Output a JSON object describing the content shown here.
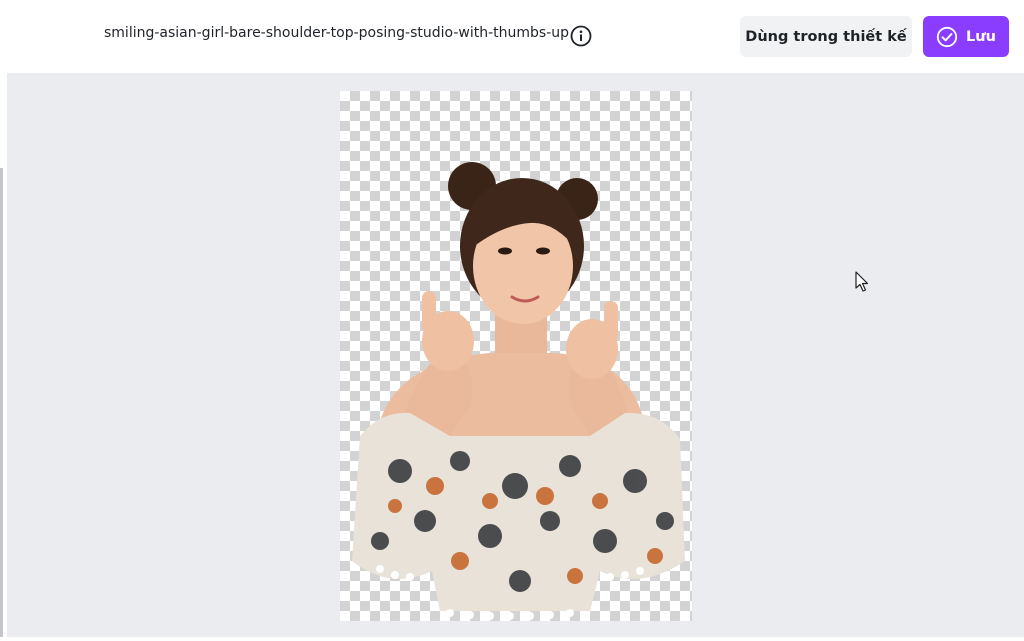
{
  "header": {
    "filename": "smiling-asian-girl-bare-shoulder-top-posing-studio-with-thumbs-up",
    "info_icon": "info-circle-icon",
    "use_in_design_label": "Dùng trong thiết kế",
    "save_label": "Lưu",
    "save_icon": "check-circle-icon"
  },
  "canvas": {
    "image_icon": "cutout-photo",
    "background": "transparent-checkerboard"
  },
  "colors": {
    "accent": "#8b3dff",
    "secondary_button": "#f1f2f4",
    "workspace": "#ebecf0"
  }
}
